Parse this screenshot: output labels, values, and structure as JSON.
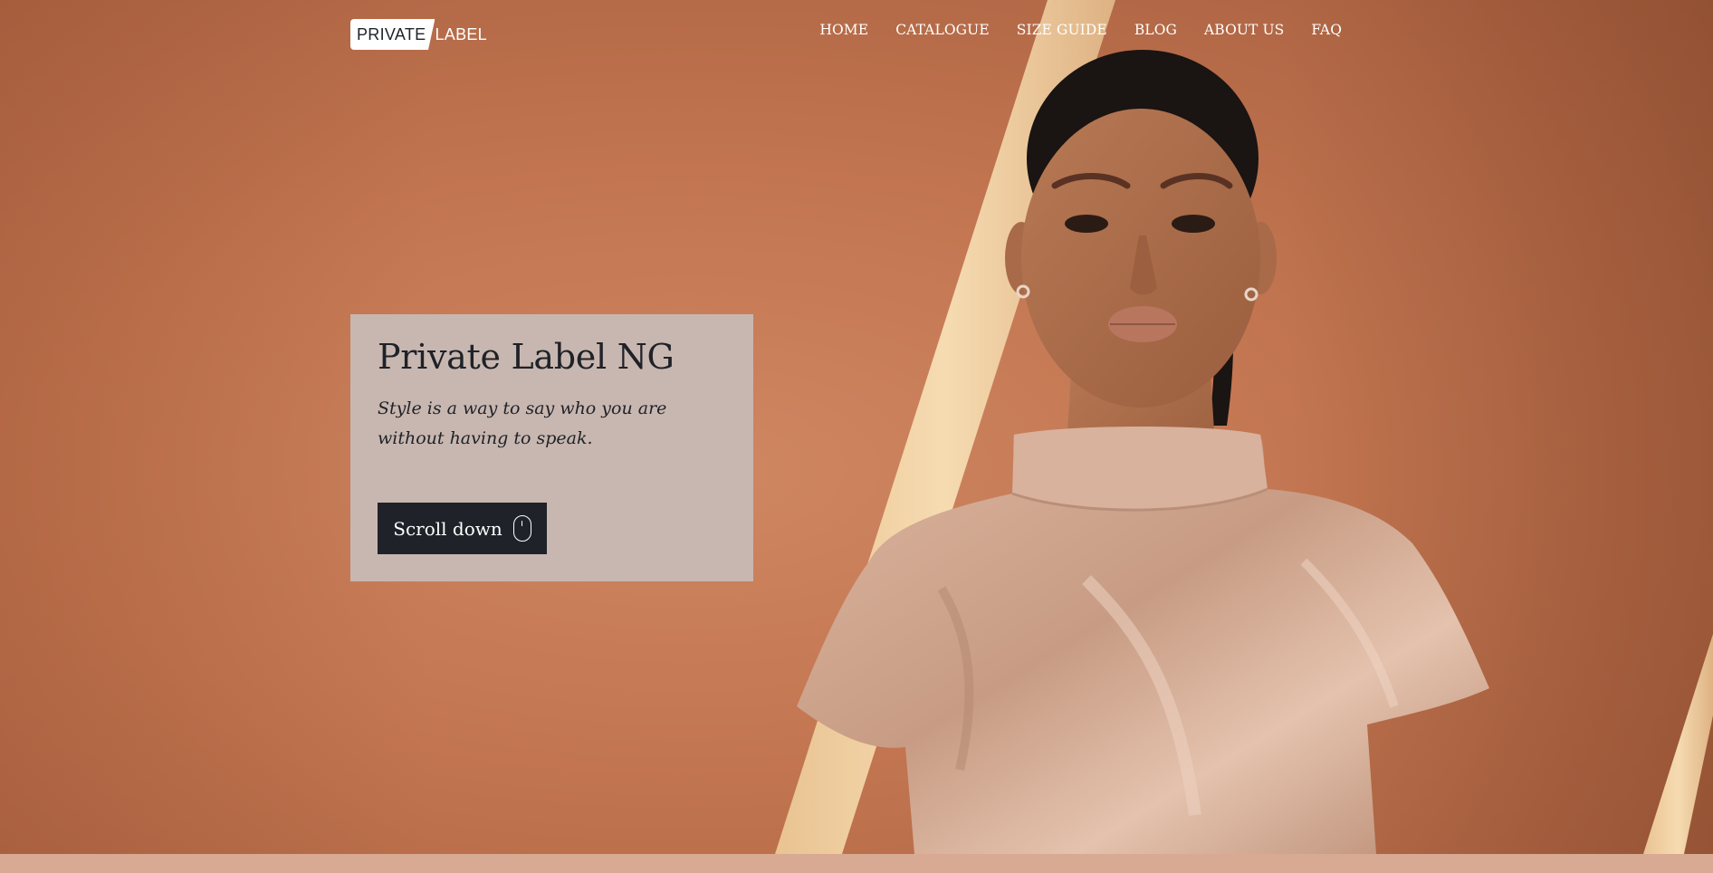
{
  "brand": {
    "logo_boxed": "PRIVATE",
    "logo_plain": "LABEL"
  },
  "nav": {
    "items": [
      {
        "label": "HOME"
      },
      {
        "label": "CATALOGUE"
      },
      {
        "label": "SIZE GUIDE"
      },
      {
        "label": "BLOG"
      },
      {
        "label": "ABOUT US"
      },
      {
        "label": "FAQ"
      }
    ]
  },
  "hero": {
    "title": "Private Label NG",
    "tagline": "Style is a way to say who you are without having to speak.",
    "button_label": "Scroll down",
    "button_icon": "mouse-icon"
  },
  "colors": {
    "background": "#c27550",
    "card": "#c8b7b0",
    "button": "#1f2329",
    "footer_band": "#d8aa93"
  }
}
